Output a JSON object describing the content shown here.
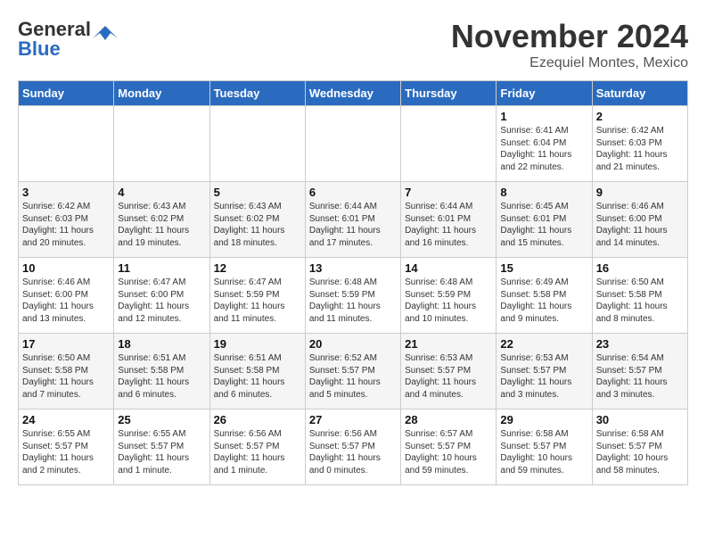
{
  "logo": {
    "general": "General",
    "blue": "Blue"
  },
  "header": {
    "month": "November 2024",
    "location": "Ezequiel Montes, Mexico"
  },
  "weekdays": [
    "Sunday",
    "Monday",
    "Tuesday",
    "Wednesday",
    "Thursday",
    "Friday",
    "Saturday"
  ],
  "weeks": [
    [
      {
        "day": "",
        "info": ""
      },
      {
        "day": "",
        "info": ""
      },
      {
        "day": "",
        "info": ""
      },
      {
        "day": "",
        "info": ""
      },
      {
        "day": "",
        "info": ""
      },
      {
        "day": "1",
        "info": "Sunrise: 6:41 AM\nSunset: 6:04 PM\nDaylight: 11 hours\nand 22 minutes."
      },
      {
        "day": "2",
        "info": "Sunrise: 6:42 AM\nSunset: 6:03 PM\nDaylight: 11 hours\nand 21 minutes."
      }
    ],
    [
      {
        "day": "3",
        "info": "Sunrise: 6:42 AM\nSunset: 6:03 PM\nDaylight: 11 hours\nand 20 minutes."
      },
      {
        "day": "4",
        "info": "Sunrise: 6:43 AM\nSunset: 6:02 PM\nDaylight: 11 hours\nand 19 minutes."
      },
      {
        "day": "5",
        "info": "Sunrise: 6:43 AM\nSunset: 6:02 PM\nDaylight: 11 hours\nand 18 minutes."
      },
      {
        "day": "6",
        "info": "Sunrise: 6:44 AM\nSunset: 6:01 PM\nDaylight: 11 hours\nand 17 minutes."
      },
      {
        "day": "7",
        "info": "Sunrise: 6:44 AM\nSunset: 6:01 PM\nDaylight: 11 hours\nand 16 minutes."
      },
      {
        "day": "8",
        "info": "Sunrise: 6:45 AM\nSunset: 6:01 PM\nDaylight: 11 hours\nand 15 minutes."
      },
      {
        "day": "9",
        "info": "Sunrise: 6:46 AM\nSunset: 6:00 PM\nDaylight: 11 hours\nand 14 minutes."
      }
    ],
    [
      {
        "day": "10",
        "info": "Sunrise: 6:46 AM\nSunset: 6:00 PM\nDaylight: 11 hours\nand 13 minutes."
      },
      {
        "day": "11",
        "info": "Sunrise: 6:47 AM\nSunset: 6:00 PM\nDaylight: 11 hours\nand 12 minutes."
      },
      {
        "day": "12",
        "info": "Sunrise: 6:47 AM\nSunset: 5:59 PM\nDaylight: 11 hours\nand 11 minutes."
      },
      {
        "day": "13",
        "info": "Sunrise: 6:48 AM\nSunset: 5:59 PM\nDaylight: 11 hours\nand 11 minutes."
      },
      {
        "day": "14",
        "info": "Sunrise: 6:48 AM\nSunset: 5:59 PM\nDaylight: 11 hours\nand 10 minutes."
      },
      {
        "day": "15",
        "info": "Sunrise: 6:49 AM\nSunset: 5:58 PM\nDaylight: 11 hours\nand 9 minutes."
      },
      {
        "day": "16",
        "info": "Sunrise: 6:50 AM\nSunset: 5:58 PM\nDaylight: 11 hours\nand 8 minutes."
      }
    ],
    [
      {
        "day": "17",
        "info": "Sunrise: 6:50 AM\nSunset: 5:58 PM\nDaylight: 11 hours\nand 7 minutes."
      },
      {
        "day": "18",
        "info": "Sunrise: 6:51 AM\nSunset: 5:58 PM\nDaylight: 11 hours\nand 6 minutes."
      },
      {
        "day": "19",
        "info": "Sunrise: 6:51 AM\nSunset: 5:58 PM\nDaylight: 11 hours\nand 6 minutes."
      },
      {
        "day": "20",
        "info": "Sunrise: 6:52 AM\nSunset: 5:57 PM\nDaylight: 11 hours\nand 5 minutes."
      },
      {
        "day": "21",
        "info": "Sunrise: 6:53 AM\nSunset: 5:57 PM\nDaylight: 11 hours\nand 4 minutes."
      },
      {
        "day": "22",
        "info": "Sunrise: 6:53 AM\nSunset: 5:57 PM\nDaylight: 11 hours\nand 3 minutes."
      },
      {
        "day": "23",
        "info": "Sunrise: 6:54 AM\nSunset: 5:57 PM\nDaylight: 11 hours\nand 3 minutes."
      }
    ],
    [
      {
        "day": "24",
        "info": "Sunrise: 6:55 AM\nSunset: 5:57 PM\nDaylight: 11 hours\nand 2 minutes."
      },
      {
        "day": "25",
        "info": "Sunrise: 6:55 AM\nSunset: 5:57 PM\nDaylight: 11 hours\nand 1 minute."
      },
      {
        "day": "26",
        "info": "Sunrise: 6:56 AM\nSunset: 5:57 PM\nDaylight: 11 hours\nand 1 minute."
      },
      {
        "day": "27",
        "info": "Sunrise: 6:56 AM\nSunset: 5:57 PM\nDaylight: 11 hours\nand 0 minutes."
      },
      {
        "day": "28",
        "info": "Sunrise: 6:57 AM\nSunset: 5:57 PM\nDaylight: 10 hours\nand 59 minutes."
      },
      {
        "day": "29",
        "info": "Sunrise: 6:58 AM\nSunset: 5:57 PM\nDaylight: 10 hours\nand 59 minutes."
      },
      {
        "day": "30",
        "info": "Sunrise: 6:58 AM\nSunset: 5:57 PM\nDaylight: 10 hours\nand 58 minutes."
      }
    ]
  ]
}
